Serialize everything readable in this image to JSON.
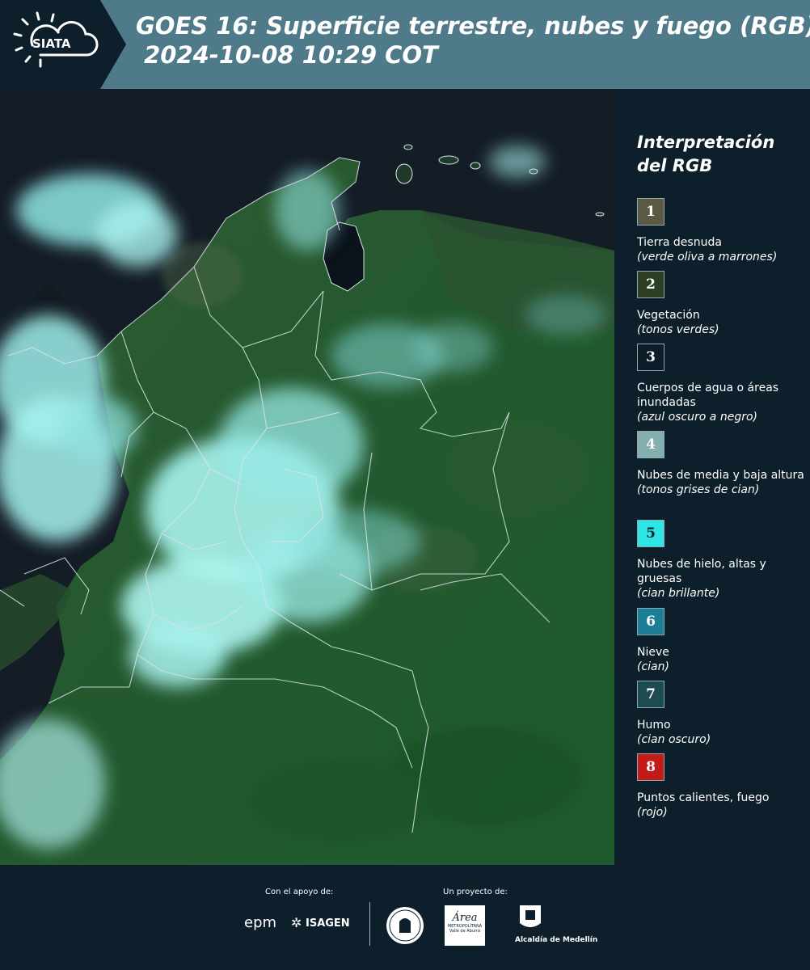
{
  "header": {
    "logo_text": "SIATA",
    "title_line1": "GOES 16: Superficie terrestre, nubes y fuego (RGB)",
    "title_line2": " 2024-10-08 10:29 COT"
  },
  "legend": {
    "title_line1": "Interpretación",
    "title_line2": "del RGB",
    "items": [
      {
        "num": "1",
        "color": "#5a5a42",
        "label": "Tierra desnuda",
        "desc": "(verde oliva a marrones)"
      },
      {
        "num": "2",
        "color": "#2d3f22",
        "label": "Vegetación",
        "desc": "(tonos verdes)"
      },
      {
        "num": "3",
        "color": "#0d1d27",
        "label": "Cuerpos de agua o áreas inundadas",
        "desc": "(azul oscuro a negro)"
      },
      {
        "num": "4",
        "color": "#85aeae",
        "label": "Nubes de media y baja altura",
        "desc": "(tonos grises de cian)"
      },
      {
        "num": "5",
        "color": "#2fe6e6",
        "label": "Nubes de hielo, altas y gruesas",
        "desc": "(cian brillante)"
      },
      {
        "num": "6",
        "color": "#1b7e96",
        "label": "Nieve",
        "desc": "(cian)"
      },
      {
        "num": "7",
        "color": "#1d4b52",
        "label": "Humo",
        "desc": "(cian oscuro)"
      },
      {
        "num": "8",
        "color": "#c41a1a",
        "label": "Puntos calientes, fuego",
        "desc": "(rojo)"
      }
    ]
  },
  "footer": {
    "support_label": "Con el apoyo de:",
    "project_label": "Un proyecto de:",
    "epm": "epm",
    "isagen": "ISAGEN",
    "area_line1": "Área",
    "area_line2": "METROPOLITANA",
    "area_line3": "Valle de Aburrá",
    "alcaldia": "Alcaldía de Medellín"
  }
}
